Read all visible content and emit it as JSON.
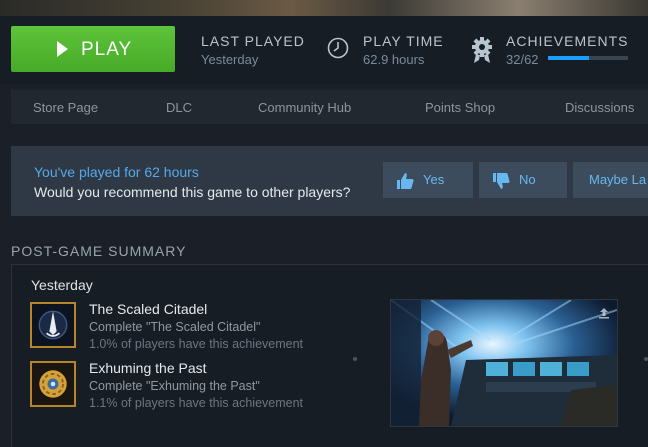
{
  "play": {
    "label": "PLAY"
  },
  "stats": {
    "last_played": {
      "label": "LAST PLAYED",
      "value": "Yesterday"
    },
    "play_time": {
      "label": "PLAY TIME",
      "value": "62.9 hours"
    },
    "achievements": {
      "label": "ACHIEVEMENTS",
      "value": "32/62",
      "progress_fraction": 0.516
    }
  },
  "nav": [
    "Store Page",
    "DLC",
    "Community Hub",
    "Points Shop",
    "Discussions"
  ],
  "recommend": {
    "hours_text": "You've played for 62 hours",
    "question": "Would you recommend this game to other players?",
    "yes": "Yes",
    "no": "No",
    "maybe": "Maybe La"
  },
  "summary": {
    "title": "POST-GAME SUMMARY",
    "day": "Yesterday",
    "achievements": [
      {
        "name": "The Scaled Citadel",
        "desc": "Complete \"The Scaled Citadel\"",
        "pct": "1.0% of players have this achievement"
      },
      {
        "name": "Exhuming the Past",
        "desc": "Complete \"Exhuming the Past\"",
        "pct": "1.1% of players have this achievement"
      }
    ]
  },
  "colors": {
    "play_green": "#5ec43a",
    "accent_blue": "#1a9fff",
    "badge_gold": "#b5862c"
  }
}
